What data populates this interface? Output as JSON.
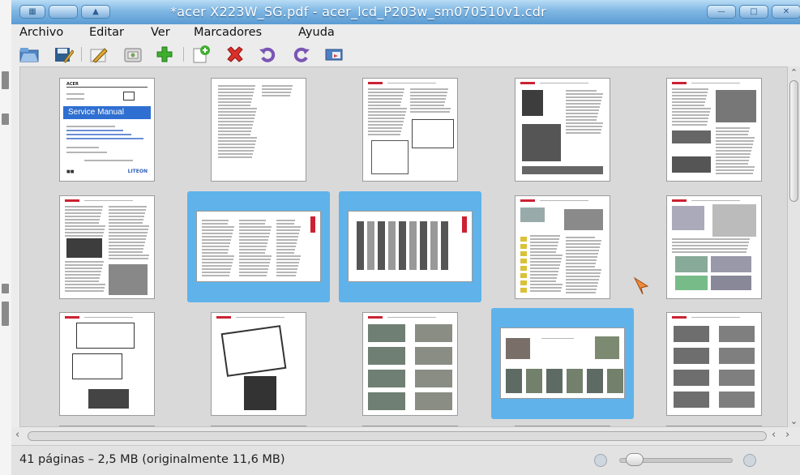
{
  "window": {
    "title": "*acer X223W_SG.pdf - acer_lcd_P203w_sm070510v1.cdr"
  },
  "menu": [
    {
      "label": "Archivo"
    },
    {
      "label": "Editar"
    },
    {
      "label": "Ver"
    },
    {
      "label": "Marcadores"
    },
    {
      "label": "Ayuda"
    }
  ],
  "toolbar": {
    "icons": [
      "open-icon",
      "save-icon",
      "edit-icon",
      "insert-icon",
      "add-icon",
      "new-page-icon",
      "delete-icon",
      "rotate-left-icon",
      "rotate-right-icon",
      "properties-icon"
    ]
  },
  "cover": {
    "brand": "ACER",
    "subtitle": "Service Manual",
    "logo": "LITEON"
  },
  "pages": [
    {
      "index": 1,
      "orientation": "portrait",
      "selected": false
    },
    {
      "index": 2,
      "orientation": "portrait",
      "selected": false
    },
    {
      "index": 3,
      "orientation": "portrait",
      "selected": false
    },
    {
      "index": 4,
      "orientation": "portrait",
      "selected": false
    },
    {
      "index": 5,
      "orientation": "portrait",
      "selected": false
    },
    {
      "index": 6,
      "orientation": "portrait",
      "selected": false
    },
    {
      "index": 7,
      "orientation": "landscape",
      "selected": true
    },
    {
      "index": 8,
      "orientation": "landscape",
      "selected": true
    },
    {
      "index": 9,
      "orientation": "portrait",
      "selected": false
    },
    {
      "index": 10,
      "orientation": "portrait",
      "selected": false
    },
    {
      "index": 11,
      "orientation": "portrait",
      "selected": false
    },
    {
      "index": 12,
      "orientation": "portrait",
      "selected": false
    },
    {
      "index": 13,
      "orientation": "portrait",
      "selected": false
    },
    {
      "index": 14,
      "orientation": "landscape",
      "selected": true
    },
    {
      "index": 15,
      "orientation": "portrait",
      "selected": false
    }
  ],
  "status": {
    "text": "41 páginas – 2,5 MB (originalmente 11,6 MB)"
  },
  "colors": {
    "selection": "#5fb3ea",
    "titlebar": "#7fb7e3"
  }
}
